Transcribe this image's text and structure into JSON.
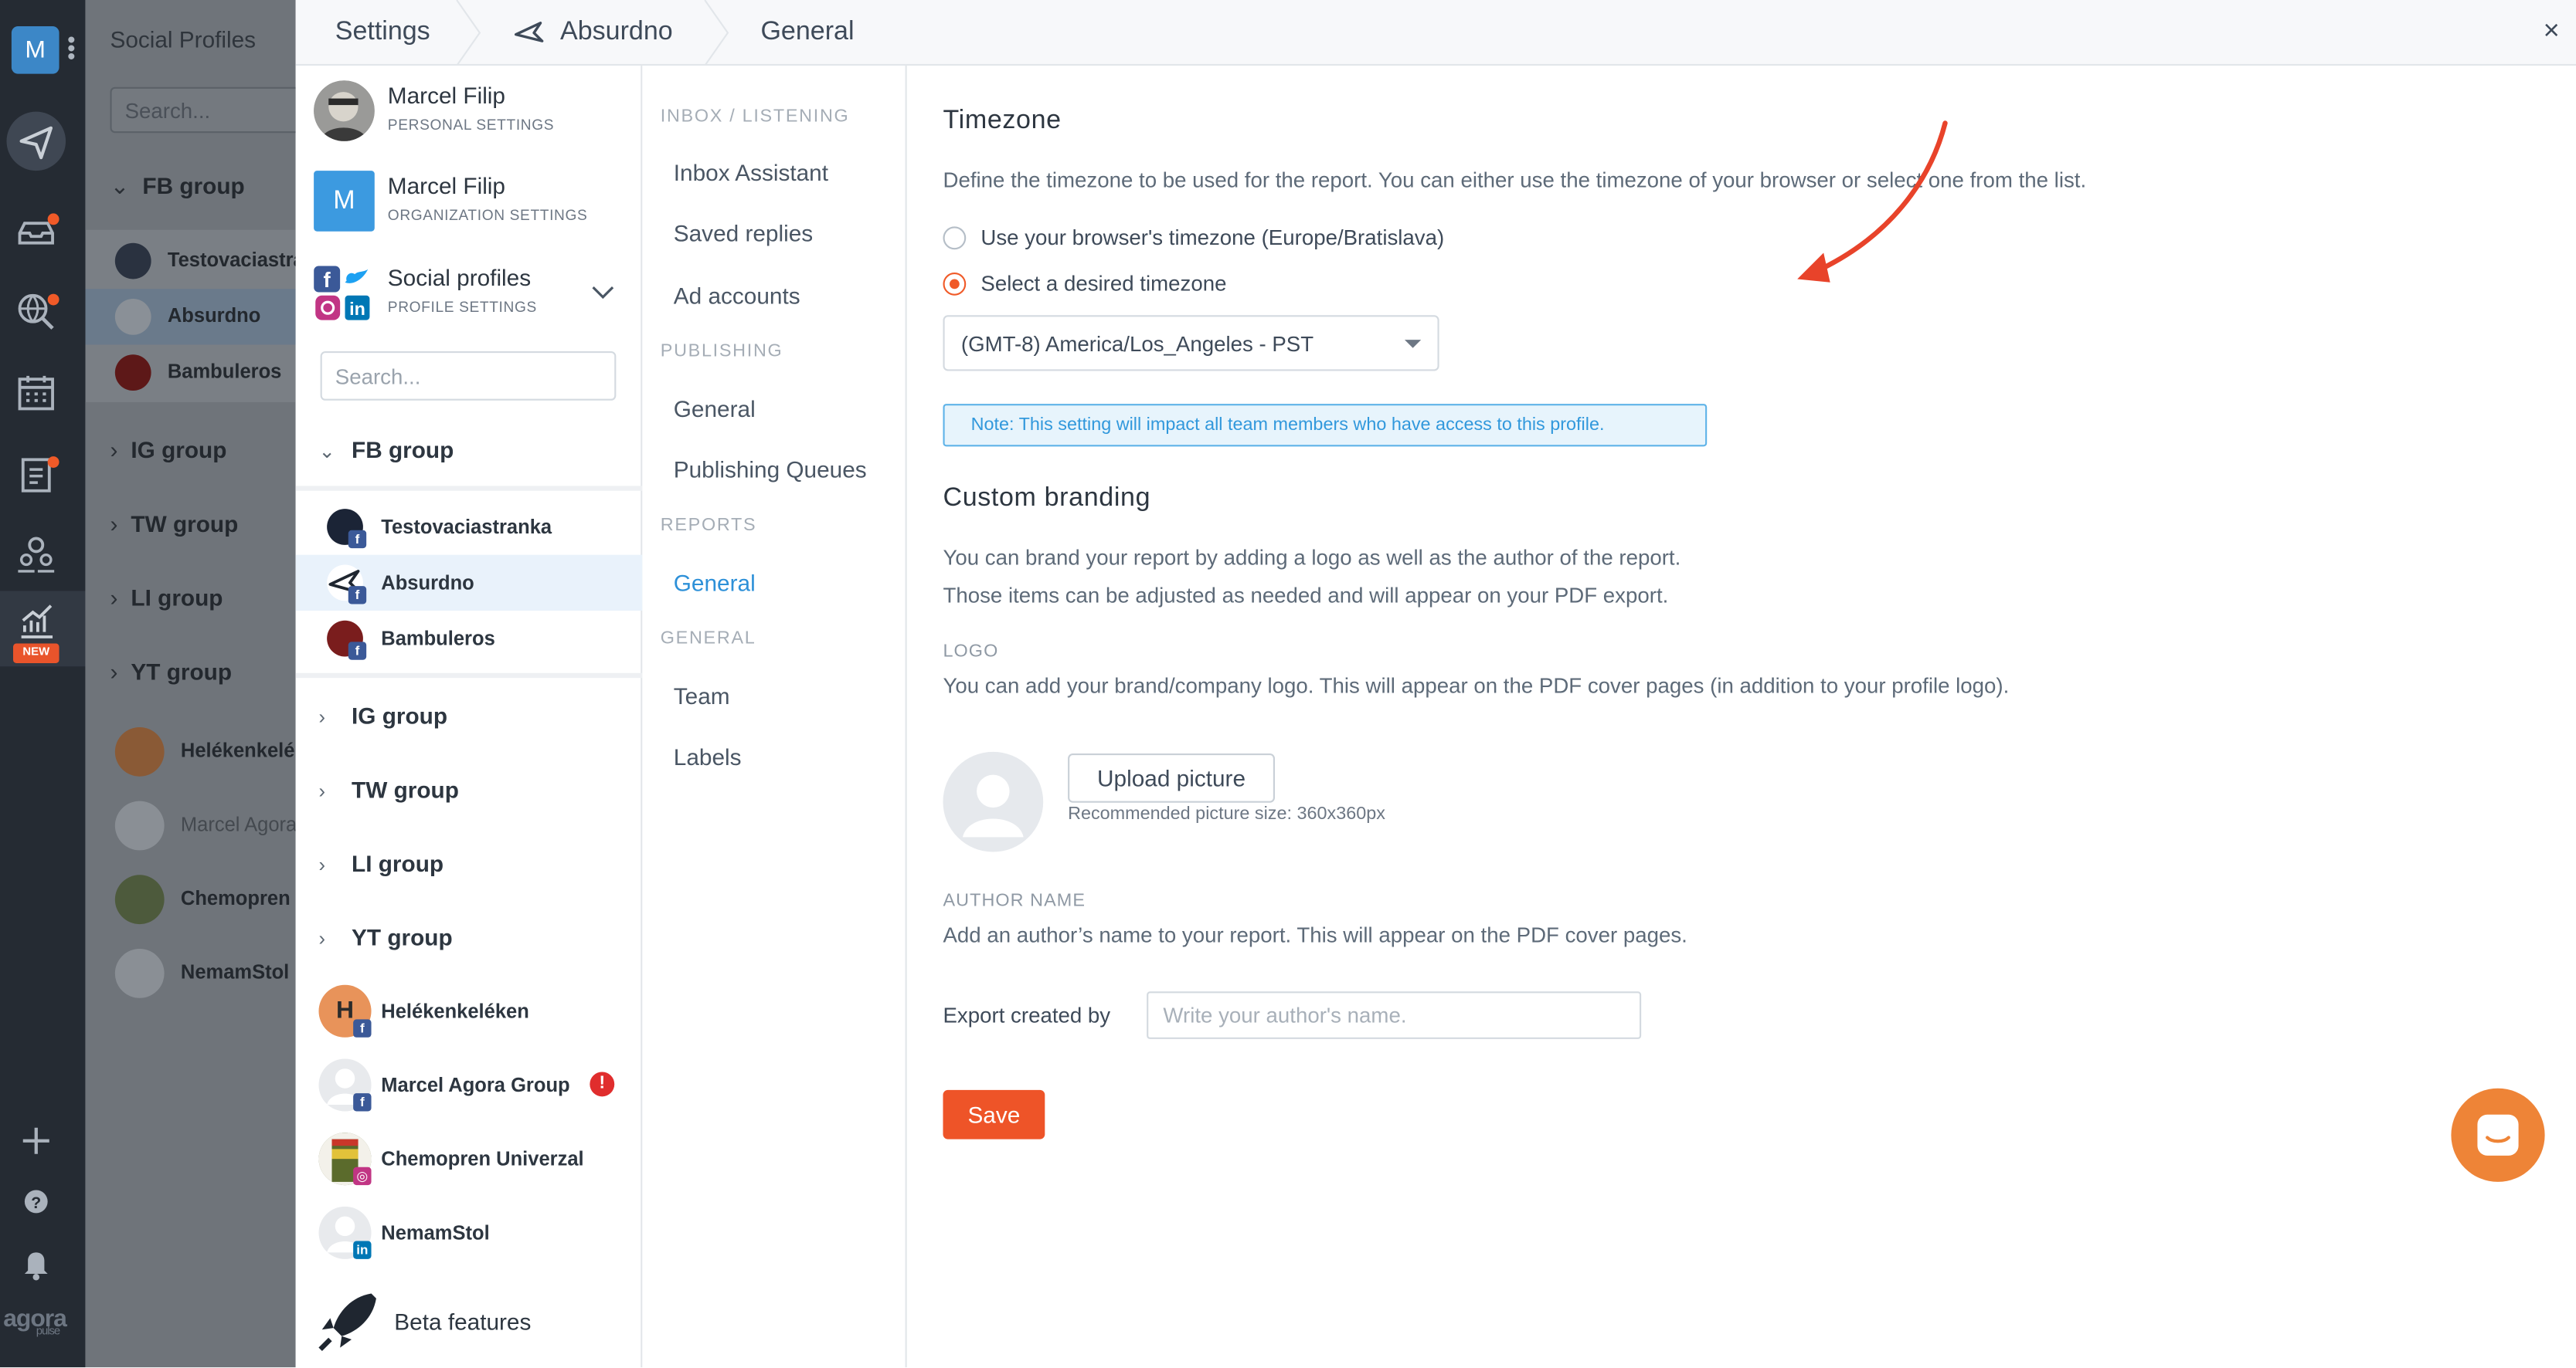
{
  "rail": {
    "account_initial": "M",
    "new_badge": "NEW",
    "logo_text": "agora",
    "logo_sub": "pulse",
    "icons": [
      "send-icon",
      "inbox-icon",
      "globe-search-icon",
      "calendar-icon",
      "clipboard-icon",
      "users-icon",
      "reports-icon",
      "plus-icon",
      "help-icon",
      "bell-icon"
    ]
  },
  "background_panel": {
    "title": "Social Profiles",
    "search_placeholder": "Search...",
    "rows": [
      {
        "label": "FB group",
        "chevron": "v"
      },
      {
        "label": "Testovaciastra"
      },
      {
        "label": "Absurdno"
      },
      {
        "label": "Bambuleros"
      },
      {
        "label": "IG group",
        "chevron": ">"
      },
      {
        "label": "TW group",
        "chevron": ">"
      },
      {
        "label": "LI group",
        "chevron": ">"
      },
      {
        "label": "YT group",
        "chevron": ">"
      },
      {
        "label": "Helékenkelék"
      },
      {
        "label": "Marcel Agora"
      },
      {
        "label": "Chemopren U"
      },
      {
        "label": "NemamStol"
      }
    ]
  },
  "header": {
    "settings": "Settings",
    "profile": "Absurdno",
    "section": "General",
    "close": "×"
  },
  "accounts": [
    {
      "name": "Marcel Filip",
      "sub": "PERSONAL SETTINGS"
    },
    {
      "name": "Marcel Filip",
      "sub": "ORGANIZATION SETTINGS",
      "initial": "M"
    },
    {
      "name": "Social profiles",
      "sub": "PROFILE SETTINGS"
    }
  ],
  "profile_search_placeholder": "Search...",
  "groups": {
    "fb": "FB group",
    "ig": "IG group",
    "tw": "TW group",
    "li": "LI group",
    "yt": "YT group"
  },
  "fb_profiles": [
    "Testovaciastranka",
    "Absurdno",
    "Bambuleros"
  ],
  "other_profiles": [
    {
      "name": "Helékenkeléken",
      "initial": "H"
    },
    {
      "name": "Marcel Agora Group",
      "alert": "!"
    },
    {
      "name": "Chemopren Univerzal"
    },
    {
      "name": "NemamStol"
    }
  ],
  "beta": "Beta features",
  "nav": {
    "sections": [
      "INBOX / LISTENING",
      "PUBLISHING",
      "REPORTS",
      "GENERAL"
    ],
    "items": {
      "inbox_assistant": "Inbox Assistant",
      "saved_replies": "Saved replies",
      "ad_accounts": "Ad accounts",
      "publishing_general": "General",
      "publishing_queues": "Publishing Queues",
      "reports_general": "General",
      "team": "Team",
      "labels": "Labels"
    },
    "active": "reports_general",
    "active_color": "#2d90d8"
  },
  "timezone": {
    "title": "Timezone",
    "description": "Define the timezone to be used for the report. You can either use the timezone of your browser or select one from the list.",
    "option_browser": "Use your browser's timezone (Europe/Bratislava)",
    "option_select": "Select a desired timezone",
    "selected_option": "option_select",
    "select_value": "(GMT-8) America/Los_Angeles - PST",
    "note": "Note: This setting will impact all team members who have access to this profile."
  },
  "branding": {
    "title": "Custom branding",
    "desc1": "You can brand your report by adding a logo as well as the author of the report.",
    "desc2": "Those items can be adjusted as needed and will appear on your PDF export.",
    "logo_label": "LOGO",
    "logo_desc": "You can add your brand/company logo. This will appear on the PDF cover pages (in addition to your profile logo).",
    "upload_button": "Upload picture",
    "upload_hint": "Recommended picture size: 360x360px",
    "author_label": "AUTHOR NAME",
    "author_desc": "Add an author’s name to your report. This will appear on the PDF cover pages.",
    "export_label": "Export created by",
    "author_placeholder": "Write your author's name.",
    "save": "Save"
  },
  "colors": {
    "accent": "#ee5428",
    "link": "#2d90d8",
    "rail": "#252b33",
    "chat": "#ee8437",
    "arrow": "#e8432a"
  }
}
